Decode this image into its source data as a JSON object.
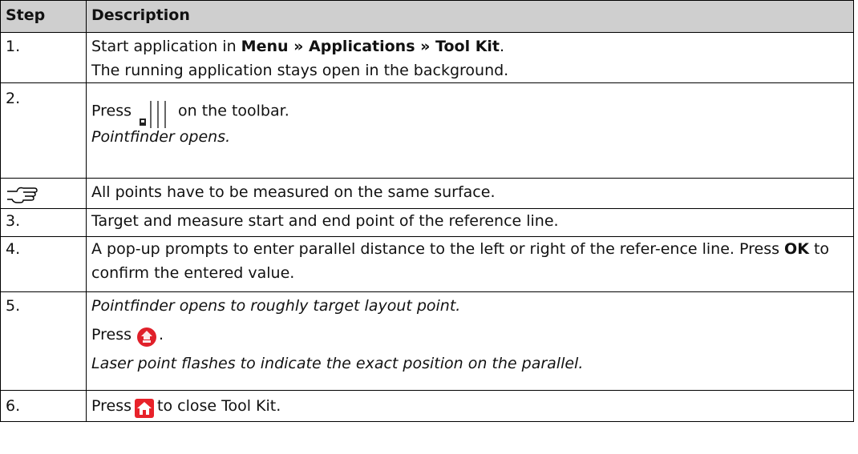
{
  "table": {
    "headers": {
      "step": "Step",
      "description": "Description"
    },
    "rows": [
      {
        "step": "1.",
        "text_pre": "Start application in ",
        "text_bold": "Menu » Applications » Tool Kit",
        "text_post": ".",
        "line2": "The running application stays open in the background."
      },
      {
        "step": "2.",
        "press": "Press",
        "after_icon": "on the toolbar.",
        "icon": "pointfinder-toolbar-icon",
        "italic": "Pointfinder opens."
      },
      {
        "step_icon": "pointing-hand-icon",
        "text": "All points have to be measured on the same surface."
      },
      {
        "step": "3.",
        "text": "Target and measure start and end point of the reference line."
      },
      {
        "step": "4.",
        "text_pre": "A pop-up prompts to enter parallel distance to the left or right of the refer-ence line. Press ",
        "text_bold": "OK",
        "text_post": " to confirm the entered value."
      },
      {
        "step": "5.",
        "italic1": "Pointfinder opens to roughly target layout point.",
        "press": "Press",
        "icon": "dist-icon",
        "after_icon": ".",
        "italic2": "Laser point flashes to indicate the exact position on the parallel."
      },
      {
        "step": "6.",
        "press": "Press",
        "icon": "home-icon",
        "after_icon": "to close Tool Kit."
      }
    ]
  },
  "colors": {
    "header_bg": "#cfcfcf",
    "dist_red": "#e0202a",
    "home_red": "#e8222a"
  }
}
